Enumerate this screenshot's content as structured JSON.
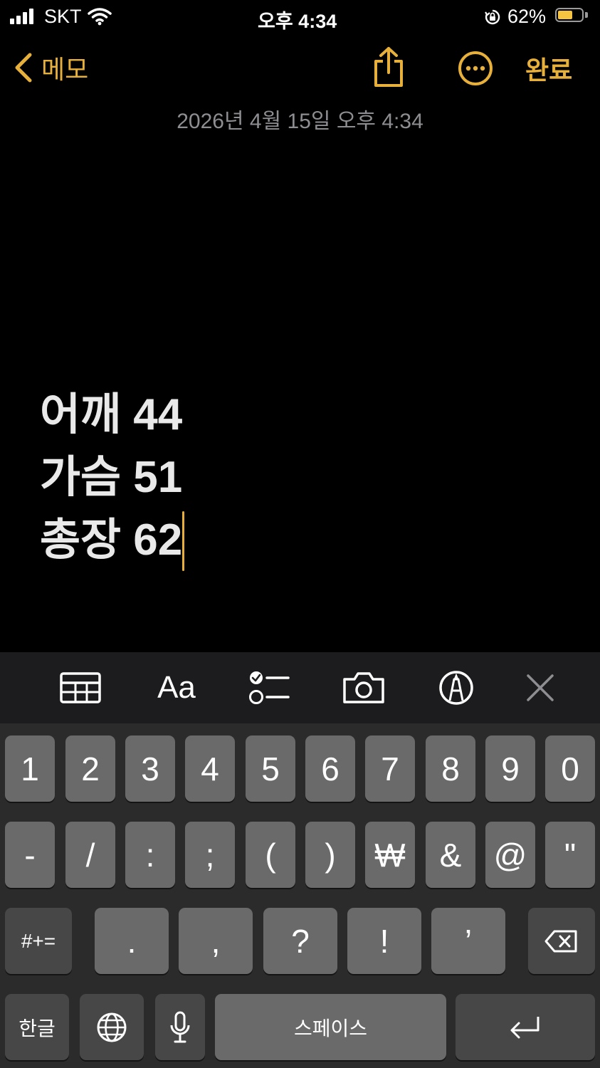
{
  "status_bar": {
    "carrier": "SKT",
    "time": "오후 4:34",
    "battery": "62%"
  },
  "nav": {
    "back_label": "메모",
    "done_label": "완료"
  },
  "note": {
    "date": "2026년 4월 15일 오후 4:34",
    "lines": [
      "어깨 44",
      "가슴 51",
      "총장 62"
    ]
  },
  "toolbar": {
    "format_label": "Aa"
  },
  "keyboard": {
    "row1": [
      "1",
      "2",
      "3",
      "4",
      "5",
      "6",
      "7",
      "8",
      "9",
      "0"
    ],
    "row2": [
      "-",
      "/",
      ":",
      ";",
      "(",
      ")",
      "₩",
      "&",
      "@",
      "\""
    ],
    "row3": {
      "symbols": "#+=",
      "keys": [
        ".",
        ",",
        "?",
        "!",
        "’"
      ]
    },
    "row4": {
      "lang": "한글",
      "space": "스페이스"
    }
  },
  "colors": {
    "accent": "#e6b03a",
    "key": "#6a6a6a",
    "key_dark": "#474747",
    "toolbar": "#1c1c1e",
    "keyboard": "#2b2b2b"
  }
}
